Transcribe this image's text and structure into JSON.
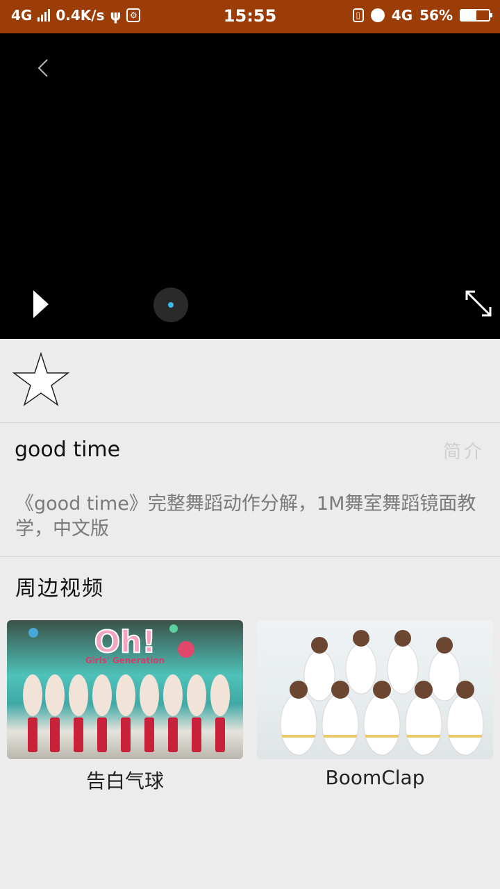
{
  "status_bar": {
    "network_left": "4G",
    "speed": "0.4K/s",
    "time": "15:55",
    "network_right": "4G",
    "battery": "56%"
  },
  "video": {
    "title": "good time",
    "intro_label": "简介",
    "description": "《good time》完整舞蹈动作分解，1M舞室舞蹈镜面教学，中文版"
  },
  "related": {
    "heading": "周边视频",
    "items": [
      {
        "title": "告白气球",
        "thumb_text": "Oh!",
        "thumb_subtext": "Girls' Generation"
      },
      {
        "title": "BoomClap"
      }
    ]
  },
  "icons": {
    "back": "back-chevron-icon",
    "play": "play-icon",
    "fullscreen": "fullscreen-icon",
    "favorite": "star-outline-icon"
  },
  "colors": {
    "status_bar": "#9c3d08",
    "player_bg": "#000000",
    "page_bg": "#ececec",
    "seek_accent": "#39b9e8"
  }
}
